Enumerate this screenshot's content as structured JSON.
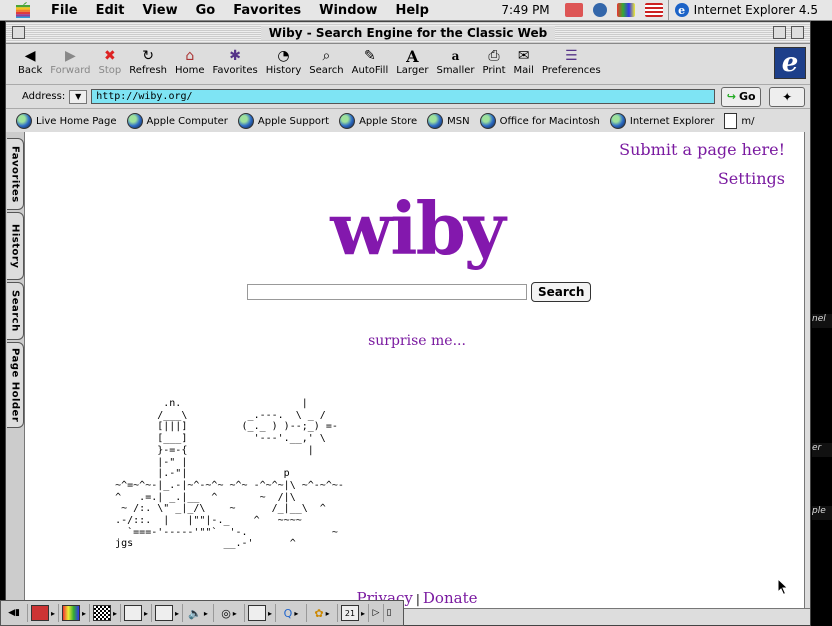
{
  "menubar": {
    "items": [
      "File",
      "Edit",
      "View",
      "Go",
      "Favorites",
      "Window",
      "Help"
    ],
    "clock": "7:49 PM",
    "app_name": "Internet Explorer 4.5"
  },
  "window": {
    "title": "Wiby - Search Engine for the Classic Web"
  },
  "toolbar": {
    "buttons": [
      {
        "label": "Back",
        "icon": "back-arrow-icon",
        "glyph": "◀"
      },
      {
        "label": "Forward",
        "icon": "forward-arrow-icon",
        "glyph": "▶",
        "disabled": true
      },
      {
        "label": "Stop",
        "icon": "stop-icon",
        "glyph": "✖",
        "disabled": true
      },
      {
        "label": "Refresh",
        "icon": "refresh-icon",
        "glyph": "↻"
      },
      {
        "label": "Home",
        "icon": "home-icon",
        "glyph": "⌂"
      },
      {
        "label": "Favorites",
        "icon": "favorites-icon",
        "glyph": "✱"
      },
      {
        "label": "History",
        "icon": "history-icon",
        "glyph": "◔"
      },
      {
        "label": "Search",
        "icon": "search-icon",
        "glyph": "⌕"
      },
      {
        "label": "AutoFill",
        "icon": "autofill-icon",
        "glyph": "✎"
      },
      {
        "label": "Larger",
        "icon": "text-larger-icon",
        "glyph": "A"
      },
      {
        "label": "Smaller",
        "icon": "text-smaller-icon",
        "glyph": "a"
      },
      {
        "label": "Print",
        "icon": "print-icon",
        "glyph": "⎙"
      },
      {
        "label": "Mail",
        "icon": "mail-icon",
        "glyph": "✉"
      },
      {
        "label": "Preferences",
        "icon": "preferences-icon",
        "glyph": "☰"
      }
    ]
  },
  "address": {
    "label": "Address:",
    "url": "http://wiby.org/",
    "go_label": "Go"
  },
  "favorites_bar": {
    "items": [
      "Live Home Page",
      "Apple Computer",
      "Apple Support",
      "Apple Store",
      "MSN",
      "Office for Macintosh",
      "Internet Explorer",
      "m/"
    ]
  },
  "side_tabs": [
    "Favorites",
    "History",
    "Search",
    "Page Holder"
  ],
  "page": {
    "submit_link": "Submit a page here!",
    "settings_link": "Settings",
    "logo": "wiby",
    "search_placeholder": "",
    "search_button": "Search",
    "surprise_link": "surprise me...",
    "ascii_art": "             .n.                    |\n            /___\\          _.---.  \\ _ /\n            [|||]         (_._ ) )--;_) =-\n            [___]           '---'.__,' \\\n            }-=-{                    |\n            |-\" |\n            |.-\"|                p\n     ~^=~^~-|_.-|~^-~^~ ~^~ -^~^~|\\ ~^-~^~-\n     ^   .=.| _.|__  ^       ~  /|\\\n      ~ /:. \\\" _|_/\\    ~      /_|__\\  ^\n     .-/::.  |   |\"\"|-._    ^   ~~~~\n       `===-'-----'\"\"`  '-.              ~\n     jgs               __.-'      ^",
    "footer_privacy": "Privacy",
    "footer_sep": "|",
    "footer_donate": "Donate"
  },
  "colors": {
    "link": "#7a1aa0",
    "logo": "#8318ad",
    "address_bg": "#7ee4f4"
  }
}
